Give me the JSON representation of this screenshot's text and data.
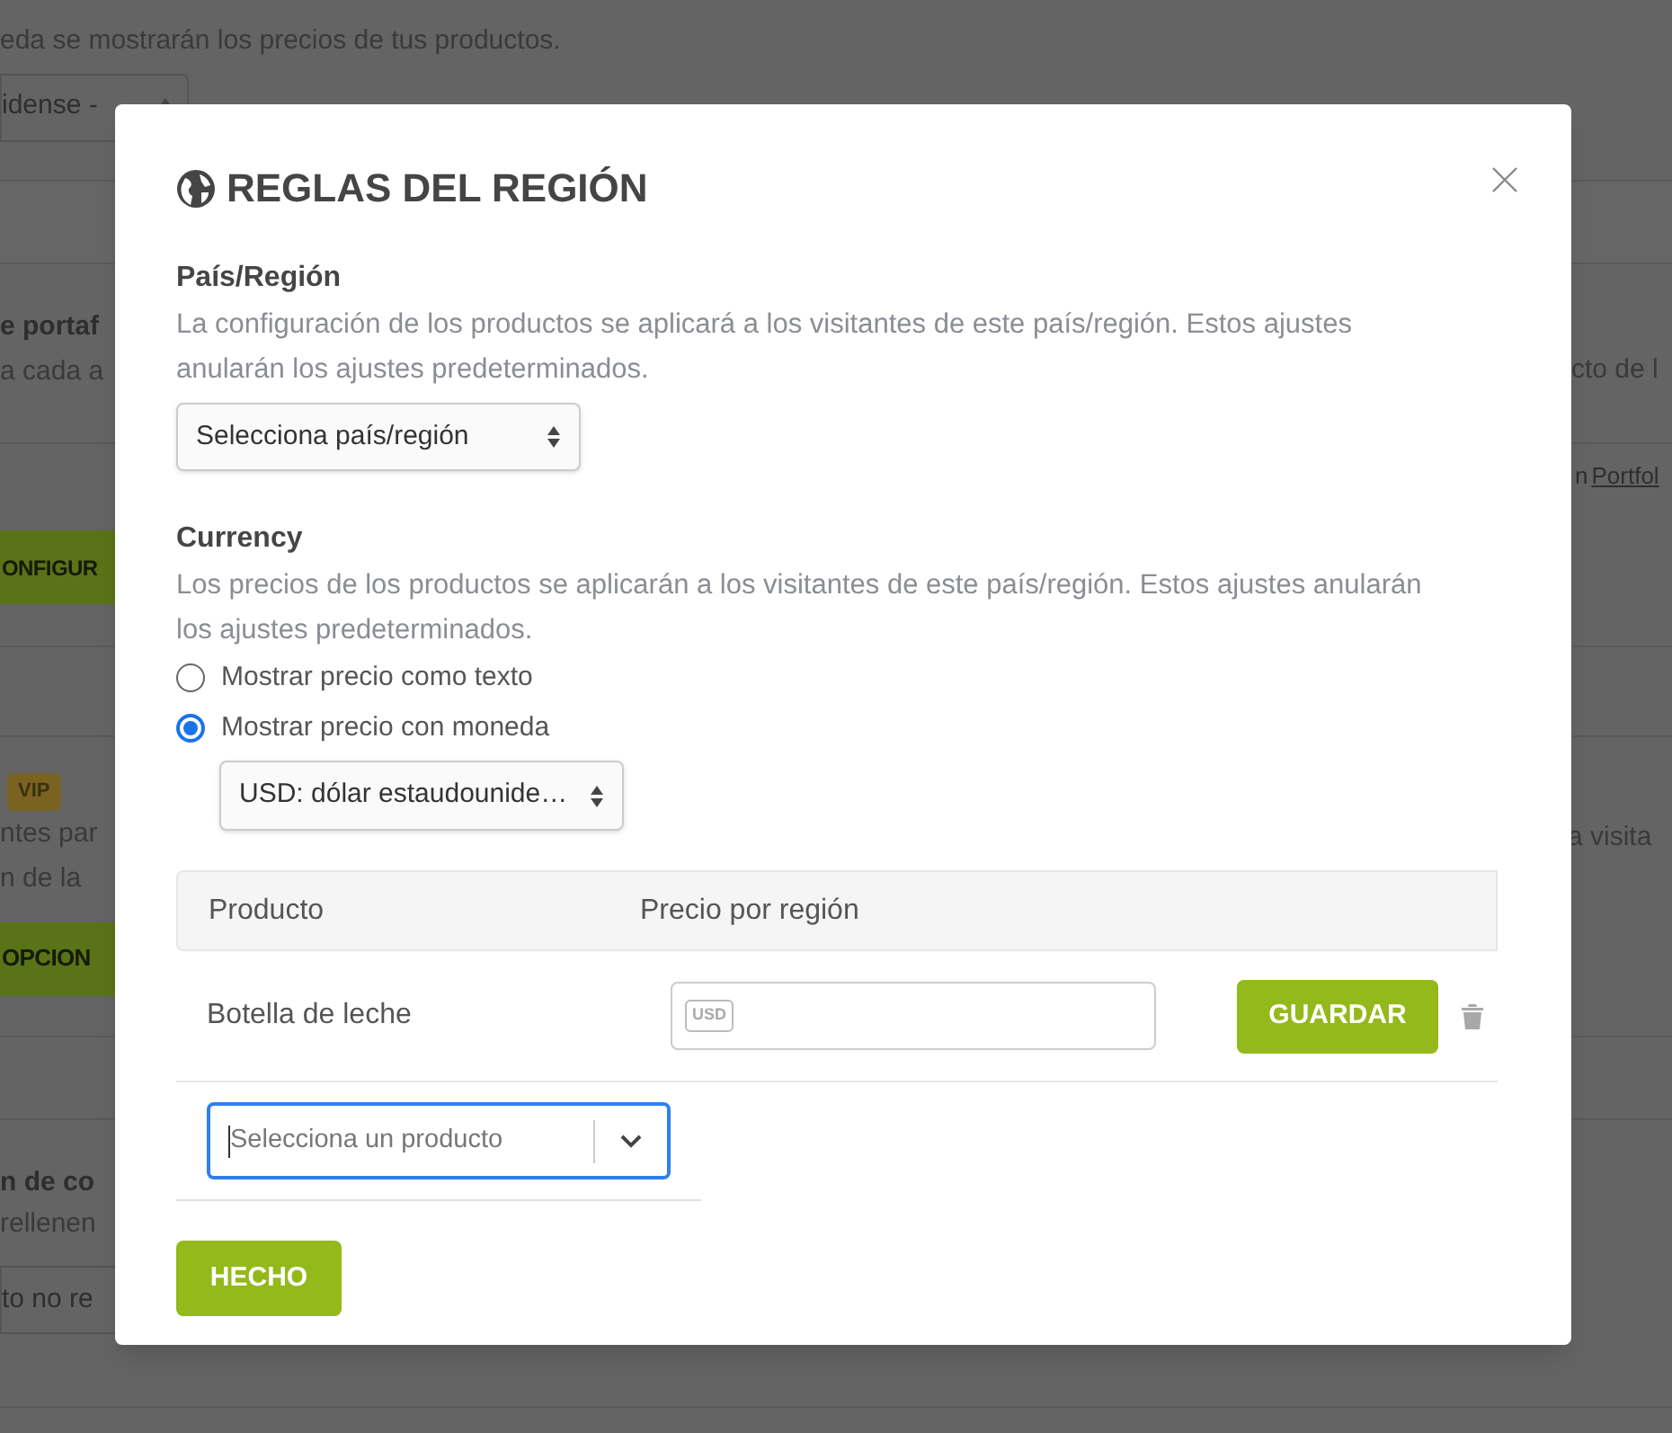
{
  "background": {
    "intro_text": "eda se mostrarán los precios de tus productos.",
    "currency_select": "idense -",
    "portfolio": {
      "title": "e portaf",
      "text": "a cada a",
      "right_text": "cto de l",
      "link_prefix": "n",
      "link": "Portfol",
      "button": "ONFIGUR"
    },
    "vip": {
      "badge": "VIP",
      "lines": [
        "ntes par",
        "n de la"
      ],
      "right_text": "a visita",
      "button": "OPCION"
    },
    "contact": {
      "title": "n de co",
      "text": "rellenen",
      "field_value": "to no re"
    }
  },
  "modal": {
    "title": "REGLAS DEL REGIÓN",
    "region": {
      "label": "País/Región",
      "help": "La configuración de los productos se aplicará a los visitantes de este país/región. Estos ajustes anularán los ajustes predeterminados.",
      "select": "Selecciona país/región"
    },
    "currency": {
      "label": "Currency",
      "help": "Los precios de los productos se aplicarán a los visitantes de este país/región. Estos ajustes anularán los ajustes predeterminados.",
      "options": [
        {
          "label": "Mostrar precio como texto",
          "selected": false
        },
        {
          "label": "Mostrar precio con moneda",
          "selected": true
        }
      ],
      "select": "USD: dólar estaudounide…"
    },
    "table": {
      "columns": [
        "Producto",
        "Precio por región"
      ],
      "rows": [
        {
          "product": "Botella de leche",
          "currency_tag": "USD",
          "button": "GUARDAR"
        }
      ]
    },
    "product_picker": {
      "placeholder": "Selecciona un producto"
    },
    "done_button": "HECHO"
  }
}
